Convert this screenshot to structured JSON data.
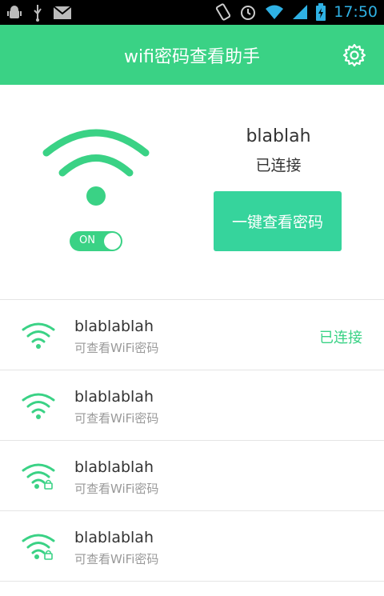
{
  "statusbar": {
    "time": "17:50"
  },
  "appbar": {
    "title": "wifi密码查看助手"
  },
  "current": {
    "ssid": "blablah",
    "status": "已连接",
    "toggle_label": "ON",
    "button_label": "一键查看密码"
  },
  "networks": [
    {
      "ssid": "blablablah",
      "subtitle": "可查看WiFi密码",
      "status": "已连接",
      "icon": "wifi-icon"
    },
    {
      "ssid": "blablablah",
      "subtitle": "可查看WiFi密码",
      "status": "",
      "icon": "wifi-icon"
    },
    {
      "ssid": "blablablah",
      "subtitle": "可查看WiFi密码",
      "status": "",
      "icon": "wifi-lock-icon"
    },
    {
      "ssid": "blablablah",
      "subtitle": "可查看WiFi密码",
      "status": "",
      "icon": "wifi-lock-icon"
    }
  ],
  "colors": {
    "accent": "#3ad285",
    "button": "#36d49c",
    "time": "#2fb1e4"
  }
}
